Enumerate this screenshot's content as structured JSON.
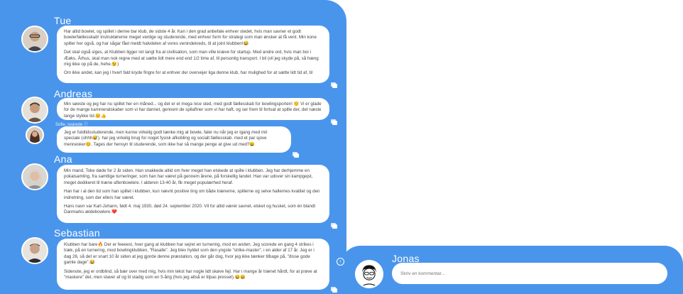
{
  "colors": {
    "panel": "#4a95ec",
    "bubble": "#ffffff"
  },
  "messages": [
    {
      "name": "Tue",
      "paragraphs": [
        "Har altid bowlet, og spillet i denne bar klub, de sidste 4 år. Kan i den grad anbefale enhver stedet, hvis man savner et godt bowlerfællesskab! Instruktørerne meget venlige og studerende, med enhver form for strategi som man ønsker at få vent. Min kone spiller her også, og har sågar fået meldt halvdelen af vores venindekreds, til at joint klubben!😂",
        "Det skal også siges, at Klubben ligger ret langt fra al civilisation, som man ville kræve for startup. Med andre ord, hvis man bor i Æøks, Århus, skal man nok regne med at sætte lidt mere end end 1/2 time af, til personlig transport. I bil (vil jeg skyde på, så hæng mig ikke op på de, hehe.😉)",
        "Om ikke andet, kan jeg i hvert fald kryde fingre for at enhver der overvejer liga denne klub, har mulighed for at sætte lidt tid af, til"
      ]
    },
    {
      "name": "Andreas",
      "paragraphs": [
        "Min søeste og jeg har nu spillet her en måned... og det er et mega nice sted, med godt fællesskab for bowlingsporten! 🙂 Vi er glade for de mange kammeratskaber som vi har dannet, gennem de spilaftner som vi har haft, og ser frem til fortsat at spille der, det næste lange stykke tid.😊👍"
      ]
    },
    {
      "reply_label": "Sofie, svarede ⓘ",
      "paragraphs": [
        "Jeg er fuldtidsstuderende, men kunne virkelig godt tænke mig at bowle, faler nu når jeg er igang med mit speciale (ohhh😅). har jeg virkelig brug for noget fysisk afkobling og socialt fællesskab. med et par sjove mennesker😊. Tages der hensyn til studerende, som ikke har så mange penge at give ud med?😄"
      ]
    },
    {
      "name": "Ana",
      "paragraphs": [
        "Min mand, Toke døde for 2 år siden. Han snakkede altid om hver meget han elskede at spille i klubben. Jeg har derhjemme en pokalsamling, fra samtlige turneringer, som han har været på gennem årene, på forskellig landet. Han var udover sin kampgejst, meget dedikeret til træne aftenbowlere. I alderen 13-40 år, fik meget populærhed heraf.",
        "Han har i al den tid som han spillet i klubben, kun nævnt positive ting om både trænerne, spillerne og selve hallernes kvalitet og den indretning, som der ellers har været.",
        "Hans navn var Karl-Johann, født 4. maj 1930, død 24. september 2020. Vil for altid været savnet, elsket og husket, som én blandt Danmarks ældebowlere.❤️"
      ]
    },
    {
      "name": "Sebastian",
      "paragraphs": [
        "Klubben har bare🔥 Der er feeeest, hver gang at klubben har sejret en turnering, mod en anden. Jeg scorede en gang 4 strikes i træk, på en turnering, mod bowlingklubben, \"Rasalle\". Jeg blev hyldet som den yngste \"strike-master\", i en alder af 17 år. Jeg er i dag 26, så det er snart 10 år siden at jeg gjorde denne præstation, og der går dog, hvor jeg ikke tænker tilbage på, \"disse gode gamle dage\".😂",
        "Sidenote, jeg er ordblind, så bær over med mig, hvis min tekst har nogle lidt skøve fejl. Har i mange år trænet hårdt, for at prøve at \"maskere\" det, men staver af og til stadig som en 5-årig (hvis jeg altså er tilpas presset).😄😄"
      ]
    }
  ],
  "composer": {
    "name": "Jonas",
    "placeholder": "Skriv en kommentar..."
  }
}
